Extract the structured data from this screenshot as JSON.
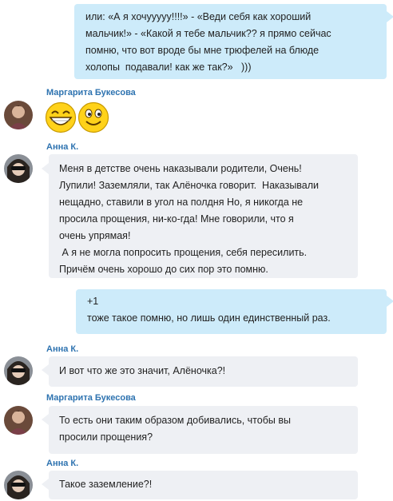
{
  "messages": [
    {
      "direction": "outgoing",
      "lines": [
        "или: «А я хочууууу!!!!» - «Веди себя как хороший",
        "мальчик!» - «Какой я тебе мальчик?? я прямо сейчас",
        "помню, что вот вроде бы мне трюфелей на блюде",
        "холопы  подавали! как же так?»   )))"
      ]
    },
    {
      "direction": "incoming",
      "author": "Маргарита Букесова",
      "emoticons": [
        "laughing-emoticon",
        "smile-emoticon"
      ]
    },
    {
      "direction": "incoming",
      "author": "Анна К.",
      "lines": [
        "Меня в детстве очень наказывали родители, Очень!",
        "Лупили! Заземляли, так Алёночка говорит.  Наказывали",
        "нещадно, ставили в угол на полдня Но, я никогда не",
        "просила прощения, ни-ко-гда! Мне говорили, что я",
        "очень упрямая!",
        " А я не могла попросить прощения, себя пересилить.",
        "Причём очень хорошо до сих пор это помню."
      ]
    },
    {
      "direction": "outgoing",
      "lines": [
        "+1",
        "тоже такое помню, но лишь один единственный раз."
      ]
    },
    {
      "direction": "incoming",
      "author": "Анна К.",
      "lines": [
        "И вот что же это значит, Алёночка?!"
      ]
    },
    {
      "direction": "incoming",
      "author": "Маргарита Букесова",
      "lines": [
        "То есть они таким образом добивались, чтобы вы",
        "просили прощения?"
      ]
    },
    {
      "direction": "incoming",
      "author": "Анна К.",
      "lines": [
        "Такое заземление?!"
      ]
    }
  ],
  "colors": {
    "outgoing_bubble": "#cdebfa",
    "incoming_bubble": "#eef0f4",
    "author_name": "#2e73b0",
    "message_text": "#222222"
  }
}
